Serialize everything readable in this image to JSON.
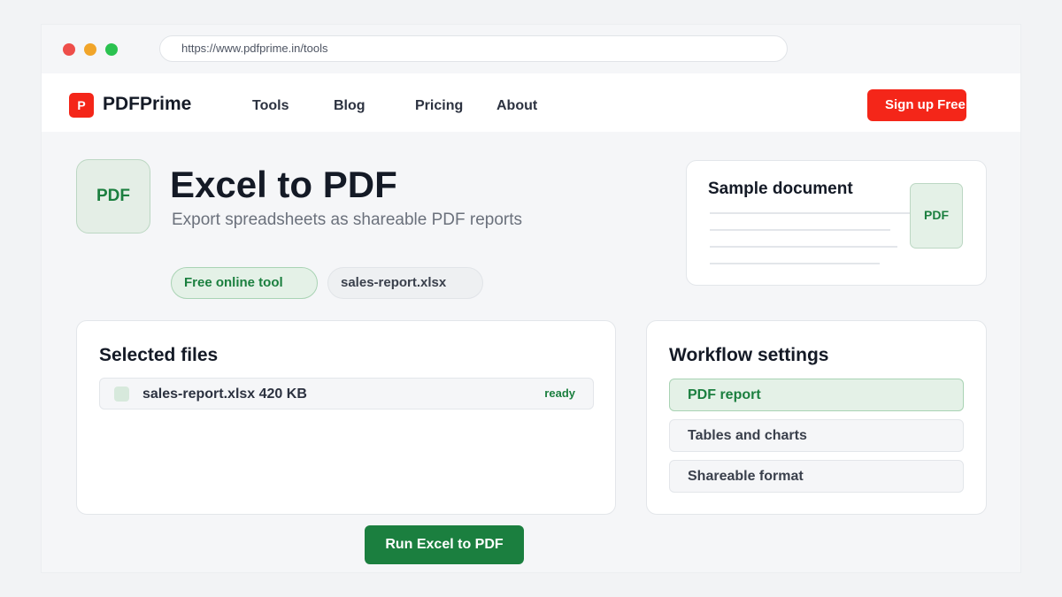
{
  "browser": {
    "url": "https://www.pdfprime.in/tools"
  },
  "nav": {
    "logo_mark": "P",
    "brand": "PDFPrime",
    "links": [
      "Tools",
      "Blog",
      "Pricing",
      "About"
    ],
    "signup_label": "Sign up Free"
  },
  "hero": {
    "icon_text": "PDF",
    "title": "Excel to PDF",
    "subtitle": "Export spreadsheets as shareable PDF reports",
    "chips": [
      "Free online tool",
      "sales-report.xlsx"
    ]
  },
  "sample": {
    "title": "Sample document",
    "badge": "PDF"
  },
  "files": {
    "title": "Selected files",
    "items": [
      {
        "name": "sales-report.xlsx 420 KB",
        "status": "ready"
      }
    ]
  },
  "settings": {
    "title": "Workflow settings",
    "options": [
      "PDF report",
      "Tables and charts",
      "Shareable format"
    ],
    "selected": "PDF report"
  },
  "action": {
    "run_label": "Run Excel to PDF"
  },
  "colors": {
    "brand_red": "#f42619",
    "accent_green": "#1b7f3f",
    "background": "#f2f3f5"
  },
  "icons": {
    "window_controls": [
      "close-dot",
      "minimize-dot",
      "maximize-dot"
    ],
    "file_icon": "file-checkbox-icon"
  }
}
